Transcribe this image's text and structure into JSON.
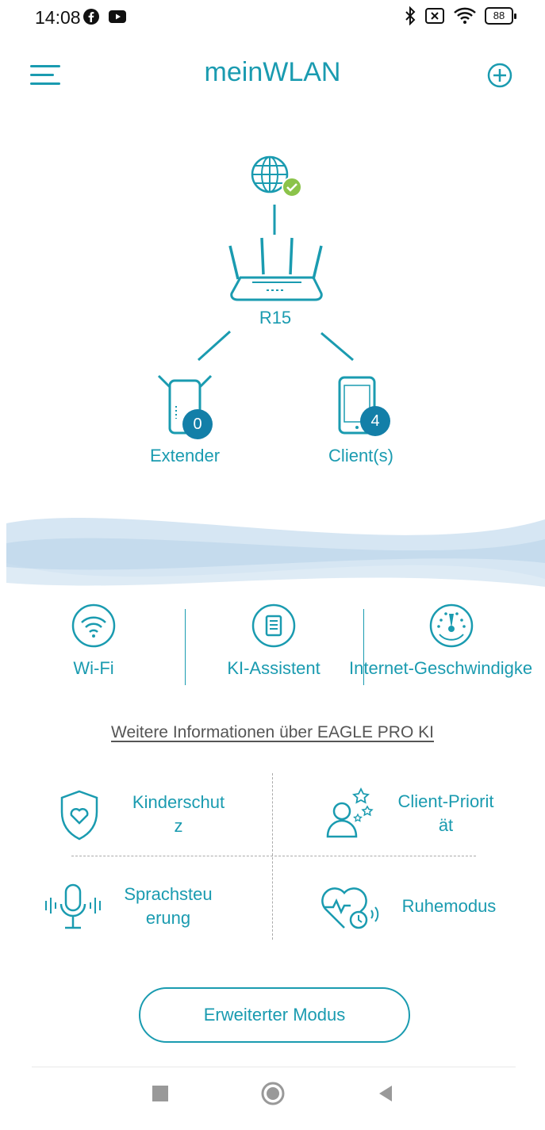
{
  "status_bar": {
    "time": "14:08",
    "battery": "88",
    "icons": [
      "facebook-icon",
      "youtube-icon",
      "bluetooth-icon",
      "sim-icon",
      "wifi-signal-icon",
      "battery-icon"
    ]
  },
  "app_bar": {
    "title": "meinWLAN",
    "menu_icon": "hamburger-menu-icon",
    "add_icon": "plus-circle-icon"
  },
  "topology": {
    "internet_icon": "globe-icon",
    "internet_status_icon": "check-icon",
    "router_label": "R15",
    "extender_label": "Extender",
    "extender_count": "0",
    "clients_label": "Client(s)",
    "clients_count": "4"
  },
  "features": [
    {
      "label": "Wi-Fi",
      "icon": "wifi-icon"
    },
    {
      "label": "KI-Assistent",
      "icon": "document-icon"
    },
    {
      "label": "Internet-Geschwindigke",
      "icon": "speedometer-icon"
    }
  ],
  "more_info_link": "Weitere Informationen über EAGLE PRO KI",
  "grid": [
    {
      "line1": "Kinderschut",
      "line2": "z",
      "icon": "shield-heart-icon"
    },
    {
      "line1": "Client-Priorit",
      "line2": "ät",
      "icon": "user-stars-icon"
    },
    {
      "line1": "Sprachsteu",
      "line2": "erung",
      "icon": "microphone-icon"
    },
    {
      "line1": "Ruhemodus",
      "line2": "",
      "icon": "heart-clock-icon"
    }
  ],
  "advanced_button": "Erweiterter Modus",
  "nav_bar": {
    "icons": [
      "recent-apps-icon",
      "home-icon",
      "back-icon"
    ]
  },
  "colors": {
    "accent": "#1a9bb0",
    "badge": "#137fa8",
    "check": "#8bc34a",
    "wave": "#c5dcee"
  }
}
